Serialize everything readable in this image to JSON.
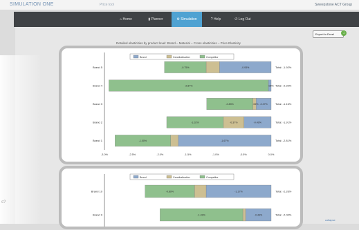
{
  "app": {
    "logo": "SIMULATION ONE",
    "subtitle": "Price tool",
    "brand": "Sweepstone ACT Group"
  },
  "nav": {
    "tabs": [
      {
        "icon": "home-icon",
        "label": "Home"
      },
      {
        "icon": "chart-icon",
        "label": "Planner"
      },
      {
        "icon": "gear-icon",
        "label": "Simulation"
      },
      {
        "icon": "help-icon",
        "label": "Help"
      },
      {
        "icon": "logout-icon",
        "label": "Log Out"
      }
    ],
    "active": "Simulation"
  },
  "export_button": "Export to Excel",
  "breadcrumb": "Detailed elasticities by product level: Brand – Material – Cross elasticities – Price Elasticity",
  "colors": {
    "brand": "#8da9cc",
    "cannibalisation": "#cdbf92",
    "competitor": "#8fc08d",
    "nav_bg": "#3f4245",
    "nav_active": "#4fa2d2"
  },
  "chart_data": [
    {
      "type": "bar",
      "stacked": true,
      "legend": [
        "Brand",
        "Cannibalisation",
        "Competitor"
      ],
      "legend_position": "top",
      "xlim": [
        -3.0,
        0.0
      ],
      "ticks": [
        "-3.0%",
        "-2.5%",
        "-2.0%",
        "-1.5%",
        "-1.0%",
        "-0.5%",
        "0.0%"
      ],
      "categories": [
        "Brand 5",
        "Brand 4",
        "Brand 3",
        "Brand 2",
        "Brand 1"
      ],
      "series": [
        {
          "name": "Brand",
          "values": [
            -0.93,
            -0.05,
            -0.27,
            -0.49,
            -1.67
          ],
          "labels": [
            "-0.93%",
            "-0.05%",
            "-0.27%",
            "-0.49%",
            "-1.67%"
          ]
        },
        {
          "name": "Cannibalisation",
          "values": [
            -0.24,
            0.0,
            -0.06,
            -0.37,
            -0.14
          ],
          "labels": [
            "",
            "",
            "-0.06%",
            "-0.37%",
            ""
          ]
        },
        {
          "name": "Competitor",
          "values": [
            -0.75,
            -2.87,
            -0.83,
            -1.02,
            -1.0
          ],
          "labels": [
            "-0.75%",
            "-2.87%",
            "-0.83%",
            "-1.02%",
            "-1.00%"
          ]
        }
      ],
      "totals": [
        "Total: -1.92%",
        "Total: -2.92%",
        "Total: -1.16%",
        "Total: -1.91%",
        "Total: -2.81%"
      ]
    },
    {
      "type": "bar",
      "stacked": true,
      "legend": [
        "Brand",
        "Cannibalisation",
        "Competitor"
      ],
      "legend_position": "top",
      "categories": [
        "Brand 10",
        "Brand 9"
      ],
      "series": [
        {
          "name": "Brand",
          "values": [
            -1.17,
            -0.46
          ],
          "labels": [
            "-1.17%",
            "-0.46%"
          ]
        },
        {
          "name": "Cannibalisation",
          "values": [
            -0.21,
            -0.05
          ],
          "labels": [
            "",
            ""
          ]
        },
        {
          "name": "Competitor",
          "values": [
            -0.89,
            -1.49
          ],
          "labels": [
            "-0.89%",
            "-1.49%"
          ]
        }
      ],
      "totals": [
        "Total: -2.26%",
        "Total: -2.00%"
      ]
    }
  ],
  "footer_link": "collapse"
}
